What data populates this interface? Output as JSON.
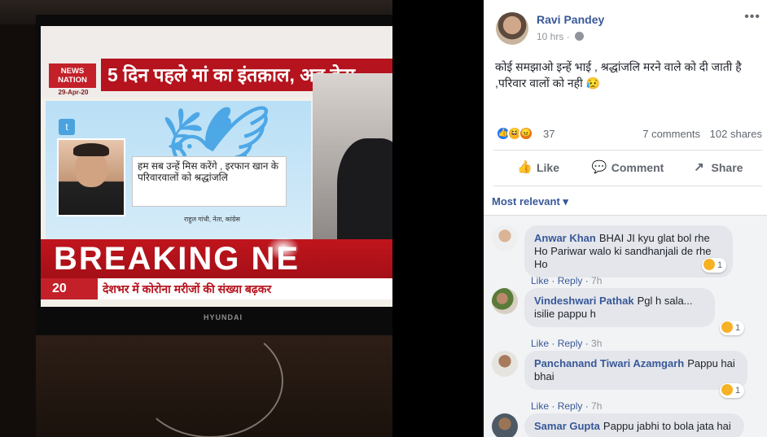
{
  "tv": {
    "logo_line1": "NEWS",
    "logo_line2": "NATION",
    "date": "29-Apr-20",
    "headline": "5 दिन पहले मां का इंतक़ाल, अब बेटा",
    "quote": "हम सब उन्हें मिस करेंगे , इरफान खान के परिवारवालों को श्रद्धांजलि",
    "attribution": "राहुल गांधी, नेता, कांग्रेस",
    "breaking": "BREAKING NE",
    "top20": "20",
    "ticker": "देशभर में कोरोना मरीजों की संख्या बढ़कर",
    "brand": "HYUNDAI"
  },
  "post": {
    "author": "Ravi Pandey",
    "time": "10 hrs",
    "text": "कोई समझाओ इन्हें भाई , श्रद्धांजलि मरने वाले को दी जाती है ,परिवार वालों को नही 😥",
    "reaction_count": "37",
    "comments_count": "7 comments",
    "shares_count": "102 shares",
    "more_label": "•••"
  },
  "actions": {
    "like": "Like",
    "comment": "Comment",
    "share": "Share"
  },
  "filter": {
    "label": "Most relevant ▾"
  },
  "comments": [
    {
      "name": "Anwar Khan",
      "text": "BHAI JI kyu glat bol rhe Ho Pariwar walo ki sandhanjali de rhe Ho",
      "like": "Like",
      "reply": "Reply",
      "time": "7h",
      "reactions": "1"
    },
    {
      "name": "Vindeshwari Pathak",
      "text": "Pgl h sala... isilie pappu h",
      "like": "Like",
      "reply": "Reply",
      "time": "3h",
      "reactions": "1"
    },
    {
      "name": "Panchanand Tiwari Azamgarh",
      "text": "Pappu hai bhai",
      "like": "Like",
      "reply": "Reply",
      "time": "7h",
      "reactions": "1"
    },
    {
      "name": "Samar Gupta",
      "text": "Pappu jabhi to bola jata hai",
      "like": "Like",
      "reply": "Reply",
      "time": "",
      "reactions": ""
    }
  ]
}
